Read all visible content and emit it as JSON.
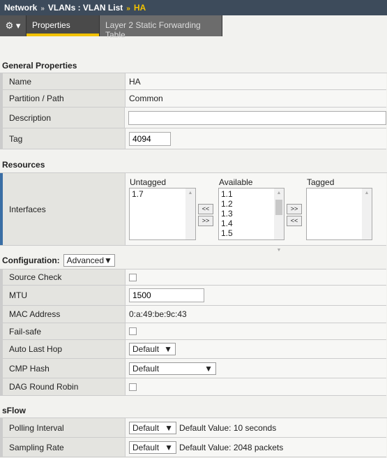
{
  "breadcrumb": {
    "items": [
      "Network",
      "VLANs : VLAN List"
    ],
    "current": "HA",
    "separator": "»"
  },
  "tabs": {
    "gear_icon": "gear-icon",
    "items": [
      "Properties",
      "Layer 2 Static Forwarding Table"
    ]
  },
  "general": {
    "title": "General Properties",
    "name_label": "Name",
    "name_value": "HA",
    "partition_label": "Partition / Path",
    "partition_value": "Common",
    "description_label": "Description",
    "description_value": "",
    "tag_label": "Tag",
    "tag_value": "4094"
  },
  "resources": {
    "title": "Resources",
    "interfaces_label": "Interfaces",
    "untagged_label": "Untagged",
    "untagged": [
      "1.7"
    ],
    "available_label": "Available",
    "available": [
      "1.1",
      "1.2",
      "1.3",
      "1.4",
      "1.5"
    ],
    "tagged_label": "Tagged",
    "tagged": [],
    "move_left": "<<",
    "move_right": ">>"
  },
  "configuration": {
    "title": "Configuration:",
    "mode": "Advanced",
    "source_check_label": "Source Check",
    "source_check": false,
    "mtu_label": "MTU",
    "mtu_value": "1500",
    "mac_label": "MAC Address",
    "mac_value": "0:a:49:be:9c:43",
    "failsafe_label": "Fail-safe",
    "failsafe": false,
    "auto_last_hop_label": "Auto Last Hop",
    "auto_last_hop": "Default",
    "cmp_hash_label": "CMP Hash",
    "cmp_hash": "Default",
    "dag_label": "DAG Round Robin",
    "dag": false
  },
  "sflow": {
    "title": "sFlow",
    "polling_label": "Polling Interval",
    "polling": "Default",
    "polling_note": "Default Value: 10 seconds",
    "sampling_label": "Sampling Rate",
    "sampling": "Default",
    "sampling_note": "Default Value: 2048 packets"
  },
  "colors": {
    "header": "#3d4b5b",
    "accent": "#f2c200"
  }
}
